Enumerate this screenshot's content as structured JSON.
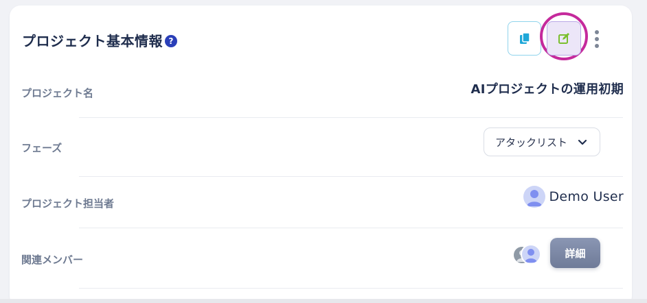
{
  "section": {
    "title": "プロジェクト基本情報",
    "help_icon": "question-circle-icon"
  },
  "toolbar": {
    "copy_icon": "copy-icon",
    "edit_icon": "edit-icon",
    "more_icon": "more-vertical-icon"
  },
  "fields": {
    "project_name": {
      "label": "プロジェクト名",
      "value": "AIプロジェクトの運用初期"
    },
    "phase": {
      "label": "フェーズ",
      "value": "アタックリスト"
    },
    "owner": {
      "label": "プロジェクト担当者",
      "value": "Demo User"
    },
    "members": {
      "label": "関連メンバー",
      "detail_button": "詳細"
    }
  },
  "colors": {
    "accent": "#2a3fb8",
    "highlight_ring": "#c52a9c",
    "edit_icon": "#7bbf2e",
    "copy_icon": "#1ea7d8"
  }
}
